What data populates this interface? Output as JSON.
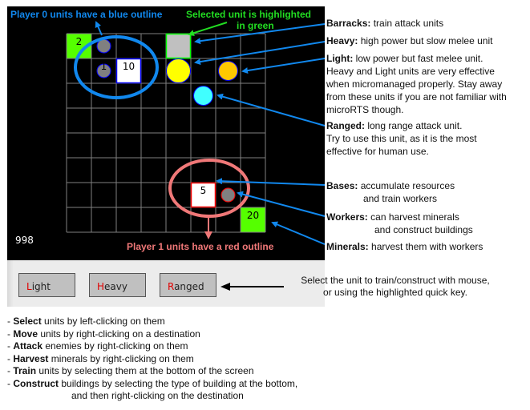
{
  "game": {
    "resources_readout": "998",
    "grid": {
      "columns": 8,
      "rows": 8
    },
    "units": [
      {
        "type": "mineral",
        "player": null,
        "col": 0,
        "row": 0,
        "label": "2",
        "color": "#55ff00"
      },
      {
        "type": "worker",
        "player": 0,
        "col": 1,
        "row": 0,
        "label": "",
        "color": "#808080"
      },
      {
        "type": "worker",
        "player": 0,
        "col": 1,
        "row": 1,
        "label": "1",
        "color": "#808080"
      },
      {
        "type": "base",
        "player": 0,
        "col": 2,
        "row": 1,
        "label": "10",
        "color": "#ffffff"
      },
      {
        "type": "barracks",
        "player": 0,
        "col": 4,
        "row": 0,
        "label": "",
        "color": "#c0c0c0",
        "selected": true
      },
      {
        "type": "heavy",
        "player": 0,
        "col": 4,
        "row": 1,
        "label": "",
        "color": "#ffff00"
      },
      {
        "type": "light",
        "player": 0,
        "col": 6,
        "row": 1,
        "label": "",
        "color": "#ffc800"
      },
      {
        "type": "ranged",
        "player": 0,
        "col": 5,
        "row": 2,
        "label": "",
        "color": "#40ffff"
      },
      {
        "type": "base",
        "player": 1,
        "col": 5,
        "row": 6,
        "label": "5",
        "color": "#ffffff"
      },
      {
        "type": "worker",
        "player": 1,
        "col": 6,
        "row": 6,
        "label": "",
        "color": "#808080"
      },
      {
        "type": "mineral",
        "player": null,
        "col": 7,
        "row": 7,
        "label": "20",
        "color": "#55ff00"
      }
    ],
    "colors": {
      "grid_line": "#808080",
      "player0_outline": "#0000ff",
      "player1_outline": "#ff0000",
      "selection": "#00ff00"
    }
  },
  "controls": {
    "buttons": [
      {
        "hotkey": "L",
        "rest": "ight",
        "name": "Light"
      },
      {
        "hotkey": "H",
        "rest": "eavy",
        "name": "Heavy"
      },
      {
        "hotkey": "R",
        "rest": "anged",
        "name": "Ranged"
      }
    ],
    "hint_line1": "Select the unit to train/construct with mouse,",
    "hint_line2": "or using the highlighted quick key."
  },
  "annotations": {
    "player0": "Player 0 units have a blue outline",
    "selected_line1": "Selected unit is highlighted",
    "selected_line2": "in green",
    "player1": "Player 1 units have a red outline",
    "colors": {
      "blue": "#1188ee",
      "green": "#22dd22",
      "pink": "#f07878"
    },
    "legend": [
      {
        "term": "Barracks:",
        "text": "train attack units"
      },
      {
        "term": "Heavy:",
        "text": "high power but slow melee unit"
      },
      {
        "term": "Light:",
        "text": "low power but fast melee unit.",
        "extra": [
          "Heavy and Light units are very effective",
          "when micromanaged properly. Stay away",
          "from these units if you are not familiar with",
          "microRTS though."
        ]
      },
      {
        "term": "Ranged:",
        "text": "long range attack unit.",
        "extra": [
          "Try to use this unit, as it is the most",
          "effective for human use."
        ]
      },
      {
        "term": "Bases:",
        "text": "accumulate resources",
        "extra": [
          "and train workers"
        ]
      },
      {
        "term": "Workers:",
        "text": "can harvest minerals",
        "extra": [
          "and construct buildings"
        ]
      },
      {
        "term": "Minerals:",
        "text": "harvest them with workers"
      }
    ]
  },
  "help": [
    {
      "verb": "Select",
      "text": " units by left-clicking on them"
    },
    {
      "verb": "Move",
      "text": " units by right-clicking on a destination"
    },
    {
      "verb": "Attack",
      "text": " enemies by right-clicking on them"
    },
    {
      "verb": "Harvest",
      "text": " minerals by right-clicking on them"
    },
    {
      "verb": "Train",
      "text": " units by selecting them at the bottom of the screen"
    },
    {
      "verb": "Construct",
      "text": " buildings by selecting the type of building at the bottom,"
    }
  ],
  "help_continuation": "and then right-clicking on the destination"
}
